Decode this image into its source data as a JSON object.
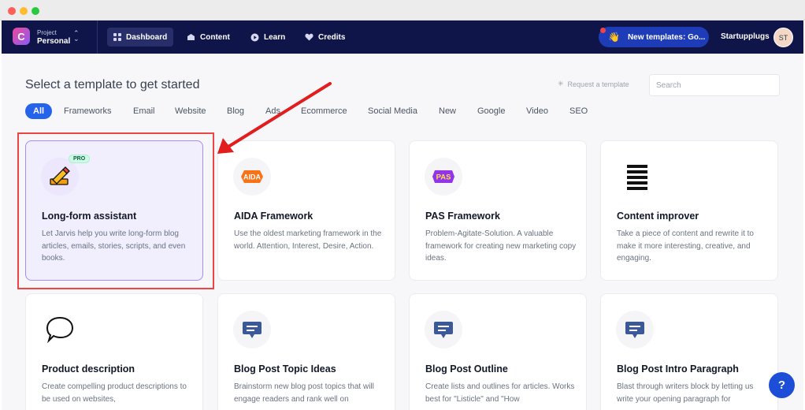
{
  "window": {
    "controls": [
      "close",
      "minimize",
      "zoom"
    ]
  },
  "nav": {
    "project_label": "Project",
    "project_name": "Personal",
    "items": [
      {
        "label": "Dashboard",
        "icon": "dashboard-icon"
      },
      {
        "label": "Content",
        "icon": "content-icon"
      },
      {
        "label": "Learn",
        "icon": "learn-icon"
      },
      {
        "label": "Credits",
        "icon": "heart-icon"
      }
    ],
    "announcement": "New templates: Go...",
    "username": "Startupplugs",
    "avatar_initials": "ST"
  },
  "page": {
    "heading": "Select a template to get started",
    "request_template": "Request a template",
    "search_placeholder": "Search"
  },
  "filters": [
    "All",
    "Frameworks",
    "Email",
    "Website",
    "Blog",
    "Ads",
    "Ecommerce",
    "Social Media",
    "New",
    "Google",
    "Video",
    "SEO"
  ],
  "active_filter": "All",
  "cards": [
    {
      "title": "Long-form assistant",
      "desc": "Let Jarvis help you write long-form blog articles, emails, stories, scripts, and even books.",
      "badge": "PRO",
      "icon": "pencil-icon"
    },
    {
      "title": "AIDA Framework",
      "desc": "Use the oldest marketing framework in the world. Attention, Interest, Desire, Action.",
      "icon_text": "AIDA",
      "icon": "aida-icon"
    },
    {
      "title": "PAS Framework",
      "desc": "Problem-Agitate-Solution. A valuable framework for creating new marketing copy ideas.",
      "icon_text": "PAS",
      "icon": "pas-icon"
    },
    {
      "title": "Content improver",
      "desc": "Take a piece of content and rewrite it to make it more interesting, creative, and engaging.",
      "icon": "lines-icon"
    },
    {
      "title": "Product description",
      "desc": "Create compelling product descriptions to be used on websites,",
      "icon": "speech-bubble-icon"
    },
    {
      "title": "Blog Post Topic Ideas",
      "desc": "Brainstorm new blog post topics that will engage readers and rank well on",
      "icon": "message-icon"
    },
    {
      "title": "Blog Post Outline",
      "desc": "Create lists and outlines for articles. Works best for \"Listicle\" and \"How",
      "icon": "message-icon"
    },
    {
      "title": "Blog Post Intro Paragraph",
      "desc": "Blast through writers block by letting us write your opening paragraph for",
      "icon": "message-icon"
    }
  ],
  "help_label": "?",
  "colors": {
    "nav_bg": "#0f1549",
    "accent": "#2563eb",
    "highlight": "#ef4444",
    "selected_card": "#a78bfa"
  }
}
